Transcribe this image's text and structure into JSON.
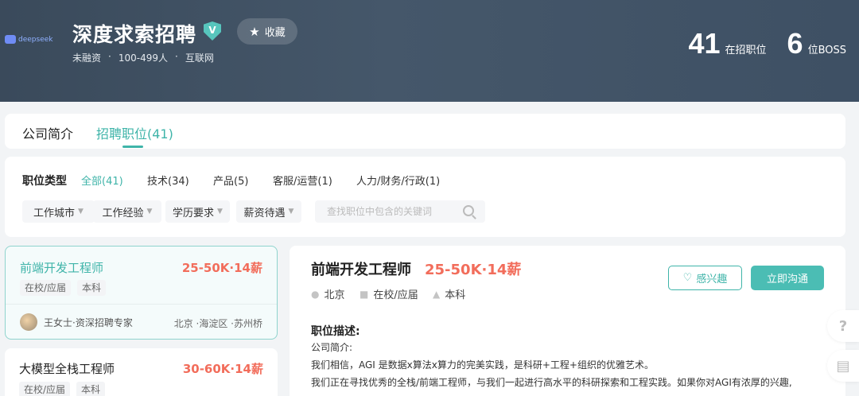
{
  "brand": {
    "logo_text": "deepseek"
  },
  "company": {
    "name": "深度求索招聘",
    "verified_mark": "V",
    "favorite_label": "收藏",
    "meta": [
      "未融资",
      "·",
      "100-499人",
      "·",
      "互联网"
    ]
  },
  "stats": {
    "positions_count": "41",
    "positions_label": "在招职位",
    "boss_count": "6",
    "boss_label": "位BOSS"
  },
  "tabs": {
    "about": "公司简介",
    "jobs": "招聘职位(41)"
  },
  "filters": {
    "type_label": "职位类型",
    "types": [
      "全部(41)",
      "技术(34)",
      "产品(5)",
      "客服/运营(1)",
      "人力/财务/行政(1)"
    ],
    "dropdowns": [
      "工作城市",
      "工作经验",
      "学历要求",
      "薪资待遇"
    ],
    "search_placeholder": "查找职位中包含的关键词"
  },
  "jobs": [
    {
      "title": "前端开发工程师",
      "salary": "25-50K·14薪",
      "tags": [
        "在校/应届",
        "本科"
      ],
      "recruiter": "王女士·资深招聘专家",
      "location": "北京 ·海淀区 ·苏州桥"
    },
    {
      "title": "大模型全栈工程师",
      "salary": "30-60K·14薪",
      "tags": [
        "在校/应届",
        "本科"
      ]
    }
  ],
  "detail": {
    "title": "前端开发工程师",
    "salary": "25-50K·14薪",
    "city": "北京",
    "experience": "在校/应届",
    "degree": "本科",
    "interest_label": "感兴趣",
    "chat_label": "立即沟通",
    "desc_title": "职位描述:",
    "desc_lines": [
      "公司简介:",
      "我们相信，AGI 是数据x算法x算力的完美实践，是科研+工程+组织的优雅艺术。",
      "我们正在寻找优秀的全栈/前端工程师，与我们一起进行高水平的科研探索和工程实践。如果你对AGI有浓厚的兴趣,"
    ]
  },
  "floating": {
    "help": "?",
    "feedback": "▤"
  },
  "colors": {
    "accent": "#3fb4a9",
    "salary": "#f26d5b",
    "header_bg": "#3e5064"
  }
}
